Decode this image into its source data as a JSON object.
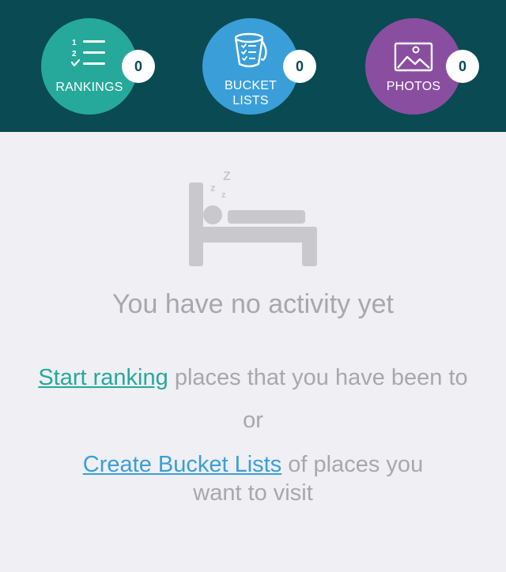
{
  "stats": {
    "rankings": {
      "label": "RANKINGS",
      "count": "0",
      "color": "#26a99a",
      "icon": "numbered-list-icon"
    },
    "bucket_lists": {
      "label_line1": "BUCKET",
      "label_line2": "LISTS",
      "count": "0",
      "color": "#3a9fd8",
      "icon": "bucket-checklist-icon"
    },
    "photos": {
      "label": "PHOTOS",
      "count": "0",
      "color": "#8a4ea0",
      "icon": "image-icon"
    }
  },
  "empty_state": {
    "icon": "sleeping-in-bed-icon",
    "title": "You have no activity yet",
    "ranking_link": "Start ranking",
    "ranking_text": " places that you have been to",
    "or": "or",
    "bucket_link": "Create Bucket Lists",
    "bucket_text_1": " of places you",
    "bucket_text_2": "want to visit"
  },
  "colors": {
    "header_bg": "#0a4a52",
    "page_bg": "#efeff4",
    "muted_text": "#a7a7ad"
  }
}
